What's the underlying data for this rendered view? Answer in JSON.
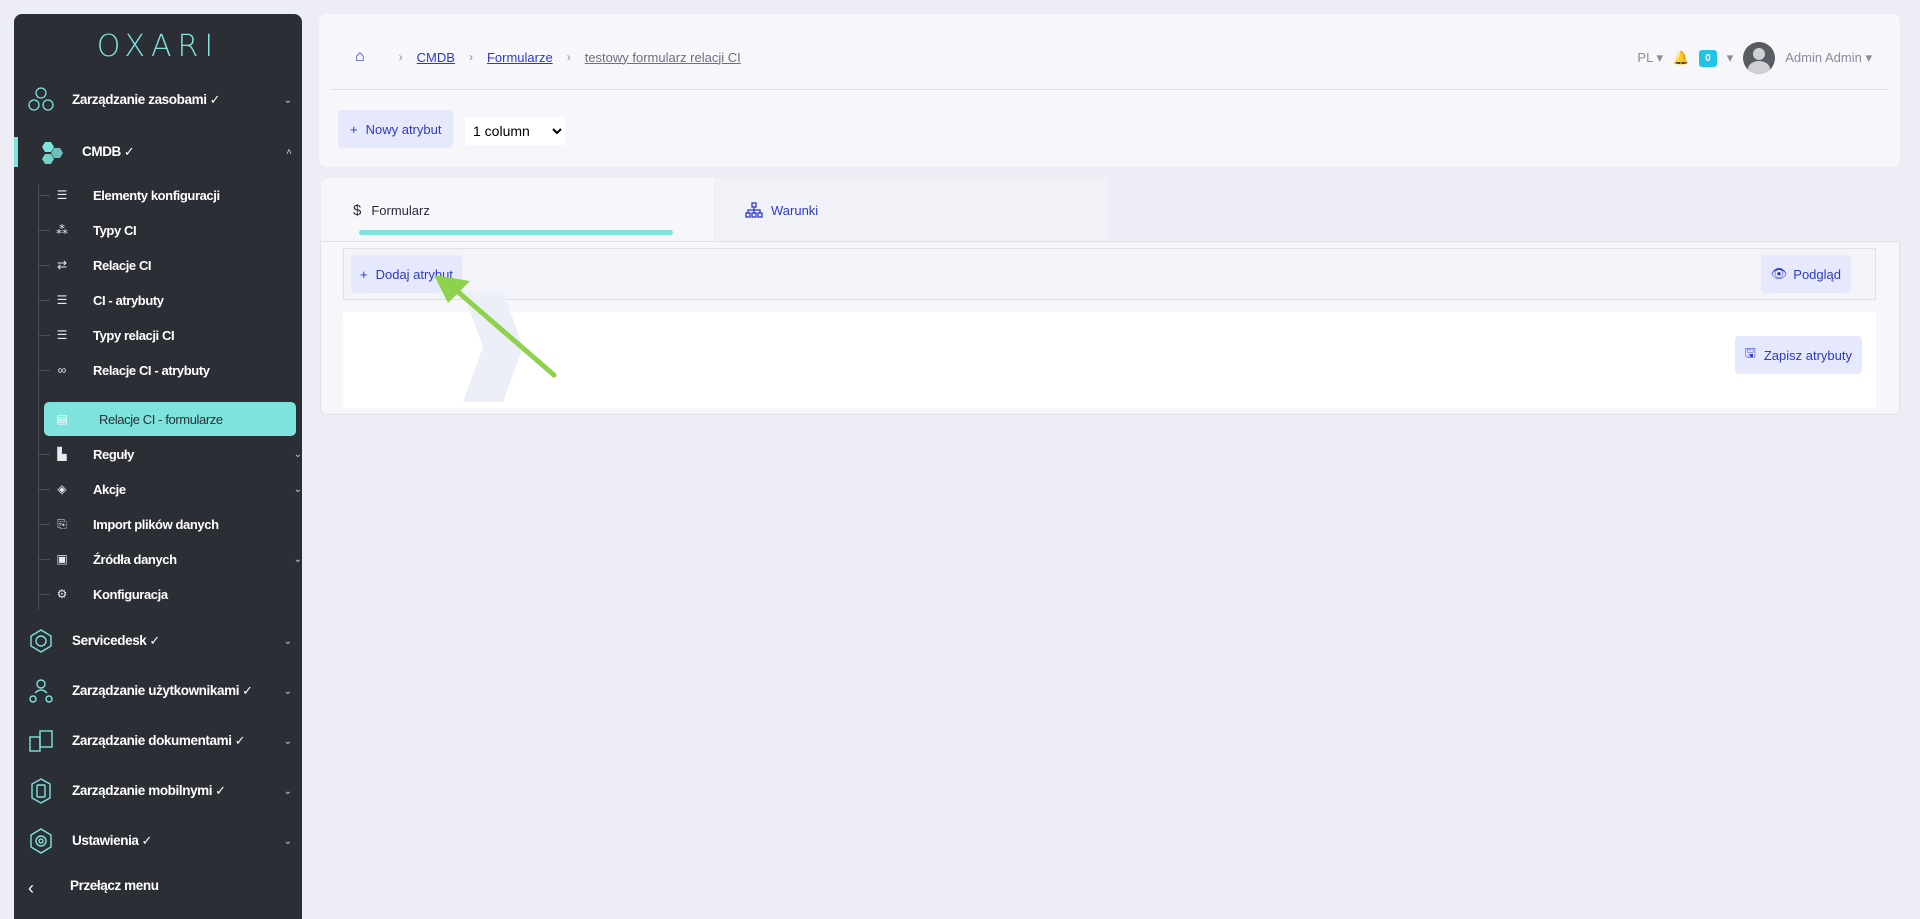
{
  "sidebar": {
    "logo": "OXARI",
    "top_items": [
      {
        "label": "Zarządzanie zasobami",
        "ok": "✓"
      },
      {
        "label": "CMDB",
        "ok": "✓"
      },
      {
        "label": "Servicedesk",
        "ok": "✓"
      },
      {
        "label": "Zarządzanie użytkownikami",
        "ok": "✓"
      },
      {
        "label": "Zarządzanie dokumentami",
        "ok": "✓"
      },
      {
        "label": "Zarządzanie mobilnymi",
        "ok": "✓"
      },
      {
        "label": "Ustawienia",
        "ok": "✓"
      }
    ],
    "cmdb_items": [
      {
        "label": "Elementy konfiguracji"
      },
      {
        "label": "Typy CI"
      },
      {
        "label": "Relacje CI"
      },
      {
        "label": "CI - atrybuty"
      },
      {
        "label": "Typy relacji CI"
      },
      {
        "label": "Relacje CI - atrybuty"
      },
      {
        "label": "Relacje CI - formularze"
      },
      {
        "label": "Reguły"
      },
      {
        "label": "Akcje"
      },
      {
        "label": "Import plików danych"
      },
      {
        "label": "Źródła danych"
      },
      {
        "label": "Konfiguracja"
      }
    ],
    "toggle_label": "Przełącz menu"
  },
  "breadcrumb": {
    "items": [
      "CMDB",
      "Formularze",
      "testowy formularz relacji CI"
    ]
  },
  "header": {
    "language": "PL",
    "notifications": "0",
    "user": "Admin Admin"
  },
  "toolbar": {
    "new_attribute": "Nowy atrybut",
    "layout_select": "1 column"
  },
  "tabs": {
    "form": "Formularz",
    "conditions": "Warunki"
  },
  "panel": {
    "add_attribute": "Dodaj atrybut",
    "preview": "Podgląd",
    "save_attributes": "Zapisz atrybuty"
  },
  "colors": {
    "accent": "#7ee3dc",
    "link": "#2c3ac8",
    "sidebar": "#2c2e35",
    "badge": "#22c3e6",
    "arrow": "#8ed14a"
  }
}
